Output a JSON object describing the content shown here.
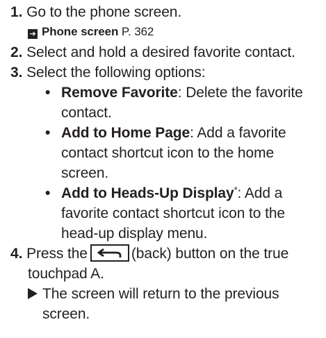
{
  "steps": [
    {
      "num": "1.",
      "text": "Go to the phone screen."
    },
    {
      "num": "2.",
      "text": "Select and hold a desired favorite contact."
    },
    {
      "num": "3.",
      "text": "Select the following options:"
    },
    {
      "num": "4.",
      "text_before": "Press the",
      "text_after": "(back) button on the true",
      "text_line2": "touchpad A."
    }
  ],
  "reference": {
    "icon": "right-arrow-box-icon",
    "label": "Phone screen",
    "page": "P. 362"
  },
  "options": [
    {
      "title": "Remove Favorite",
      "desc_first": ": Delete the favorite",
      "desc_lines": [
        "contact."
      ]
    },
    {
      "title": "Add to Home Page",
      "desc_first": ": Add a favorite",
      "desc_lines": [
        "contact shortcut icon to the home",
        "screen."
      ]
    },
    {
      "title": "Add to Heads-Up Display",
      "marker": "*",
      "desc_first": ": Add a",
      "desc_lines": [
        "favorite contact shortcut icon to the",
        "head-up display menu."
      ]
    }
  ],
  "result": {
    "icon": "result-triangle-icon",
    "line1": "The screen will return to the previous",
    "line2": "screen."
  },
  "back_button_icon": "back-arrow-icon"
}
